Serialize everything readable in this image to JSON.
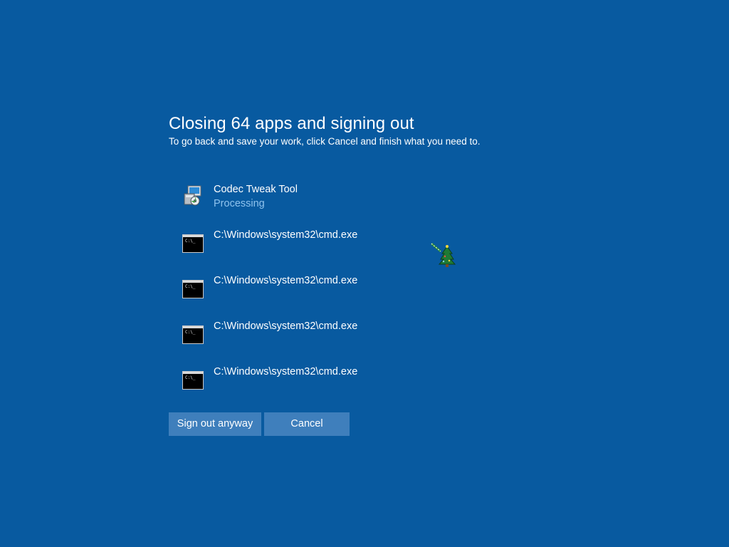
{
  "header": {
    "title": "Closing 64 apps and signing out",
    "subtitle": "To go back and save your work, click Cancel and finish what you need to."
  },
  "apps": [
    {
      "name": "Codec Tweak Tool",
      "status": "Processing",
      "icon": "installer-icon"
    },
    {
      "name": "C:\\Windows\\system32\\cmd.exe",
      "status": "",
      "icon": "cmd-icon"
    },
    {
      "name": "C:\\Windows\\system32\\cmd.exe",
      "status": "",
      "icon": "cmd-icon"
    },
    {
      "name": "C:\\Windows\\system32\\cmd.exe",
      "status": "",
      "icon": "cmd-icon"
    },
    {
      "name": "C:\\Windows\\system32\\cmd.exe",
      "status": "",
      "icon": "cmd-icon"
    }
  ],
  "cmd_prompt_glyph": "C:\\_",
  "buttons": {
    "sign_out": "Sign out anyway",
    "cancel": "Cancel"
  },
  "colors": {
    "background": "#085aa0",
    "button": "#3f7fbc",
    "status_text": "#8fc3ee"
  },
  "cursor": {
    "icon": "christmas-tree-cursor-icon"
  }
}
